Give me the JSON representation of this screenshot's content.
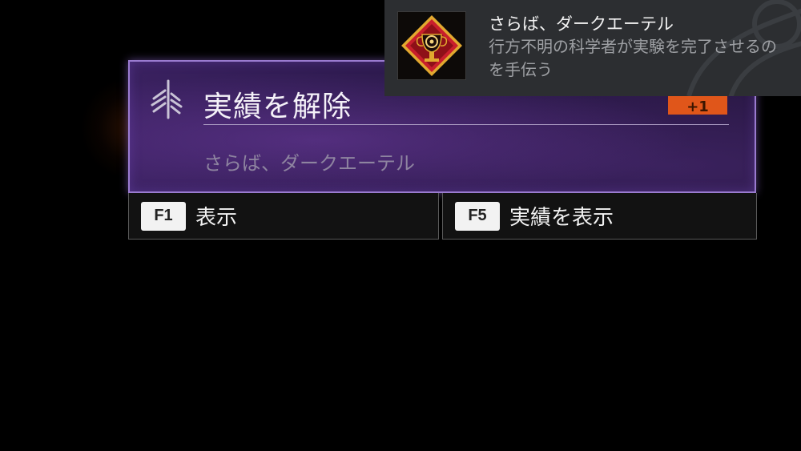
{
  "achievement_card": {
    "heading": "実績を解除",
    "achievement_name": "さらば、ダークエーテル",
    "badge_text": "+1"
  },
  "hints": [
    {
      "key": "F1",
      "label": "表示"
    },
    {
      "key": "F5",
      "label": "実績を表示"
    }
  ],
  "toast": {
    "title": "さらば、ダークエーテル",
    "description": "行方不明の科学者が実験を完了させるのを手伝う",
    "icon": "trophy-diamond-icon"
  },
  "colors": {
    "card_border": "#9a7bd0",
    "card_background": "#2d1a4d",
    "badge": "#e0561a",
    "toast_background": "#2c2e31",
    "icon_diamond": "#c81e2c",
    "icon_gold": "#e2a82f"
  }
}
